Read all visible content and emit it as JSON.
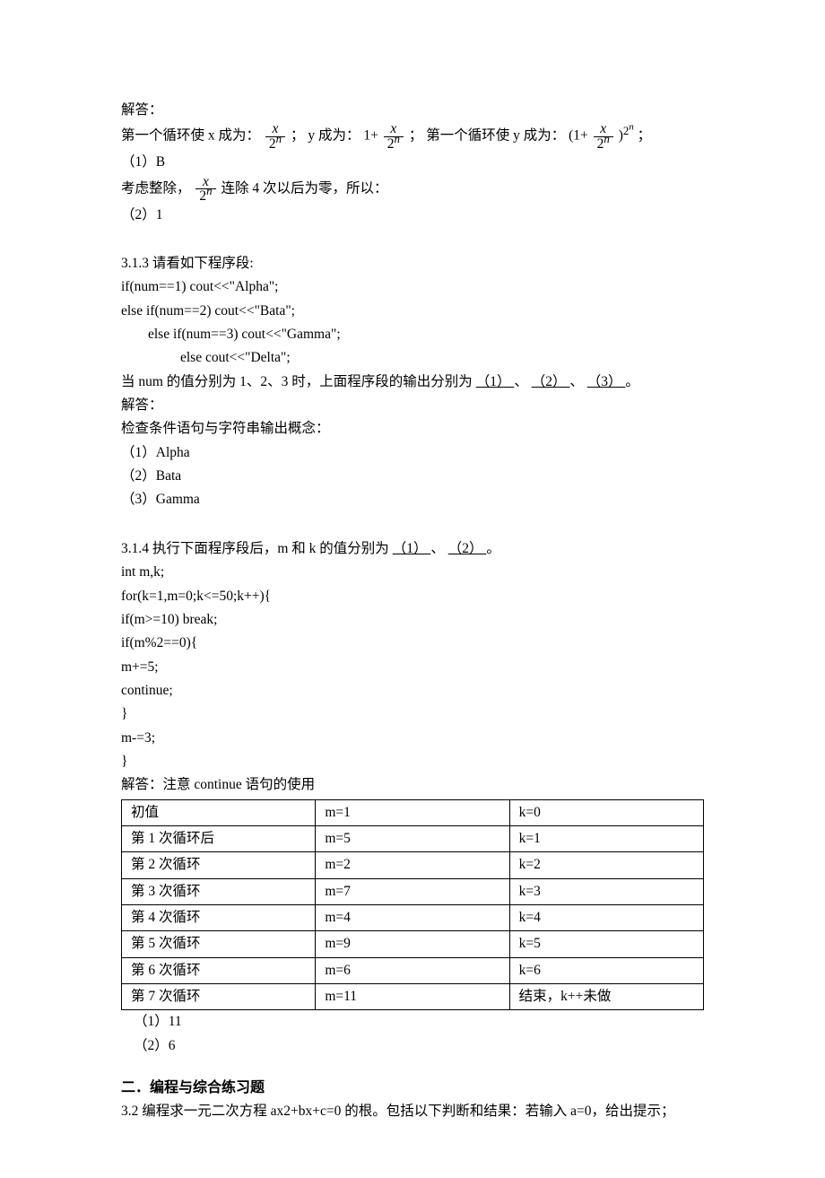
{
  "top": {
    "ans_label": "解答：",
    "line1_a": "第一个循环使 x 成为：",
    "frac1_num": "x",
    "frac1_den_base": "2",
    "frac1_den_sup": "n",
    "line1_b": "； y 成为：",
    "y1_prefix": "1+",
    "frac2_num": "x",
    "frac2_den_base": "2",
    "frac2_den_sup": "n",
    "line1_c": "； 第一个循环使 y 成为：",
    "y2_prefix": "(1+",
    "y2_suffix": ")",
    "frac3_num": "x",
    "frac3_den_base": "2",
    "frac3_den_sup": "n",
    "outer_exp_base": "2",
    "outer_exp_sup": "n",
    "line1_end": "；",
    "a1": "（1）B",
    "consider_a": "考虑整除，",
    "frac4_num": "x",
    "frac4_den_base": "2",
    "frac4_den_sup": "n",
    "consider_b": "连除 4 次以后为零，所以：",
    "a2": "（2）1"
  },
  "q313": {
    "title": "3.1.3  请看如下程序段:",
    "c1": "if(num==1)    cout<<\"Alpha\";",
    "c2": "else if(num==2)    cout<<\"Bata\";",
    "c3": "else if(num==3)    cout<<\"Gamma\";",
    "c4": "else cout<<\"Delta\";",
    "qline_a": "当 num 的值分别为 1、2、3 时，上面程序段的输出分别为",
    "b1": "（1）  ",
    "sep": "、",
    "b2": "（2）  ",
    "b3": "（3）  ",
    "end": "。",
    "ans_label": "解答：",
    "concept": "检查条件语句与字符串输出概念：",
    "a1": "（1）Alpha",
    "a2": "（2）Bata",
    "a3": "（3）Gamma"
  },
  "q314": {
    "title_a": "3.1.4 执行下面程序段后，m 和 k 的值分别为",
    "b1": "    （1）    ",
    "sep": "、 ",
    "b2": "    （2）    ",
    "end": "。",
    "c1": "int m,k;",
    "c2": "for(k=1,m=0;k<=50;k++){",
    "c3": "if(m>=10) break;",
    "c4": "if(m%2==0){",
    "c5": "m+=5;",
    "c6": "continue;",
    "c7": "}",
    "c8": "m-=3;",
    "c9": "}",
    "ans_note": "解答：注意 continue 语句的使用",
    "table": [
      {
        "c0": "初值",
        "c1": "m=1",
        "c2": "k=0"
      },
      {
        "c0": "第 1 次循环后",
        "c1": "m=5",
        "c2": "k=1"
      },
      {
        "c0": "第 2 次循环",
        "c1": "m=2",
        "c2": "k=2"
      },
      {
        "c0": "第 3 次循环",
        "c1": "m=7",
        "c2": "k=3"
      },
      {
        "c0": "第 4 次循环",
        "c1": "m=4",
        "c2": "k=4"
      },
      {
        "c0": "第 5 次循环",
        "c1": "m=9",
        "c2": "k=5"
      },
      {
        "c0": "第 6 次循环",
        "c1": "m=6",
        "c2": "k=6"
      },
      {
        "c0": "第 7 次循环",
        "c1": "m=11",
        "c2": "结束，k++未做"
      }
    ],
    "a1": "（1）11",
    "a2": "（2）6"
  },
  "section2": {
    "heading": "二．编程与综合练习题",
    "q32": "3.2 编程求一元二次方程 ax2+bx+c=0 的根。包括以下判断和结果：若输入 a=0，给出提示；"
  }
}
